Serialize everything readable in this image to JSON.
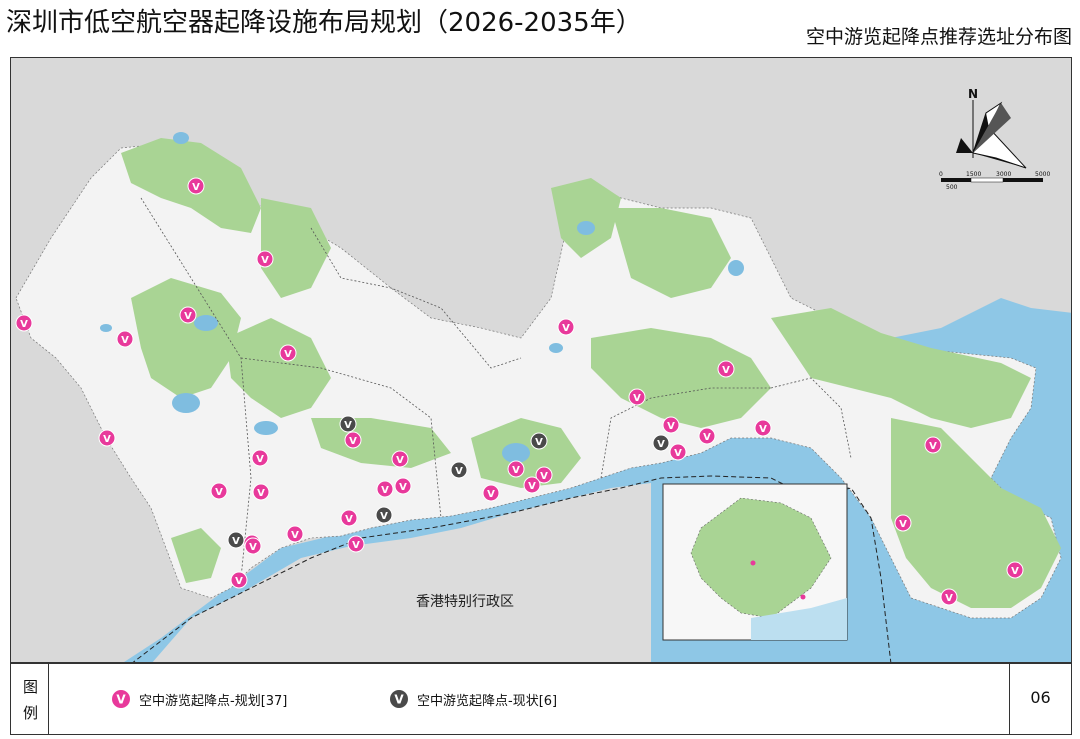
{
  "header": {
    "title": "深圳市低空航空器起降设施布局规划（2026-2035年）",
    "subtitle": "空中游览起降点推荐选址分布图"
  },
  "map": {
    "region_label": "香港特别行政区",
    "north_label": "N",
    "scale_labels": [
      "0",
      "1500",
      "3000",
      "5000",
      "500"
    ],
    "colors": {
      "water": "#8ec7e6",
      "land": "#d8d8d8",
      "urban": "#f4f4f4",
      "green": "#a9d494",
      "planned": "#e8399b",
      "existing": "#4a4a4a"
    },
    "marker_glyph": "V"
  },
  "legend": {
    "title_chars": [
      "图",
      "例"
    ],
    "items": [
      {
        "label": "空中游览起降点-规划[37]",
        "type": "planned",
        "icon": "v-pin-magenta-icon"
      },
      {
        "label": "空中游览起降点-现状[6]",
        "type": "existing",
        "icon": "v-pin-gray-icon"
      }
    ],
    "page_number": "06"
  }
}
